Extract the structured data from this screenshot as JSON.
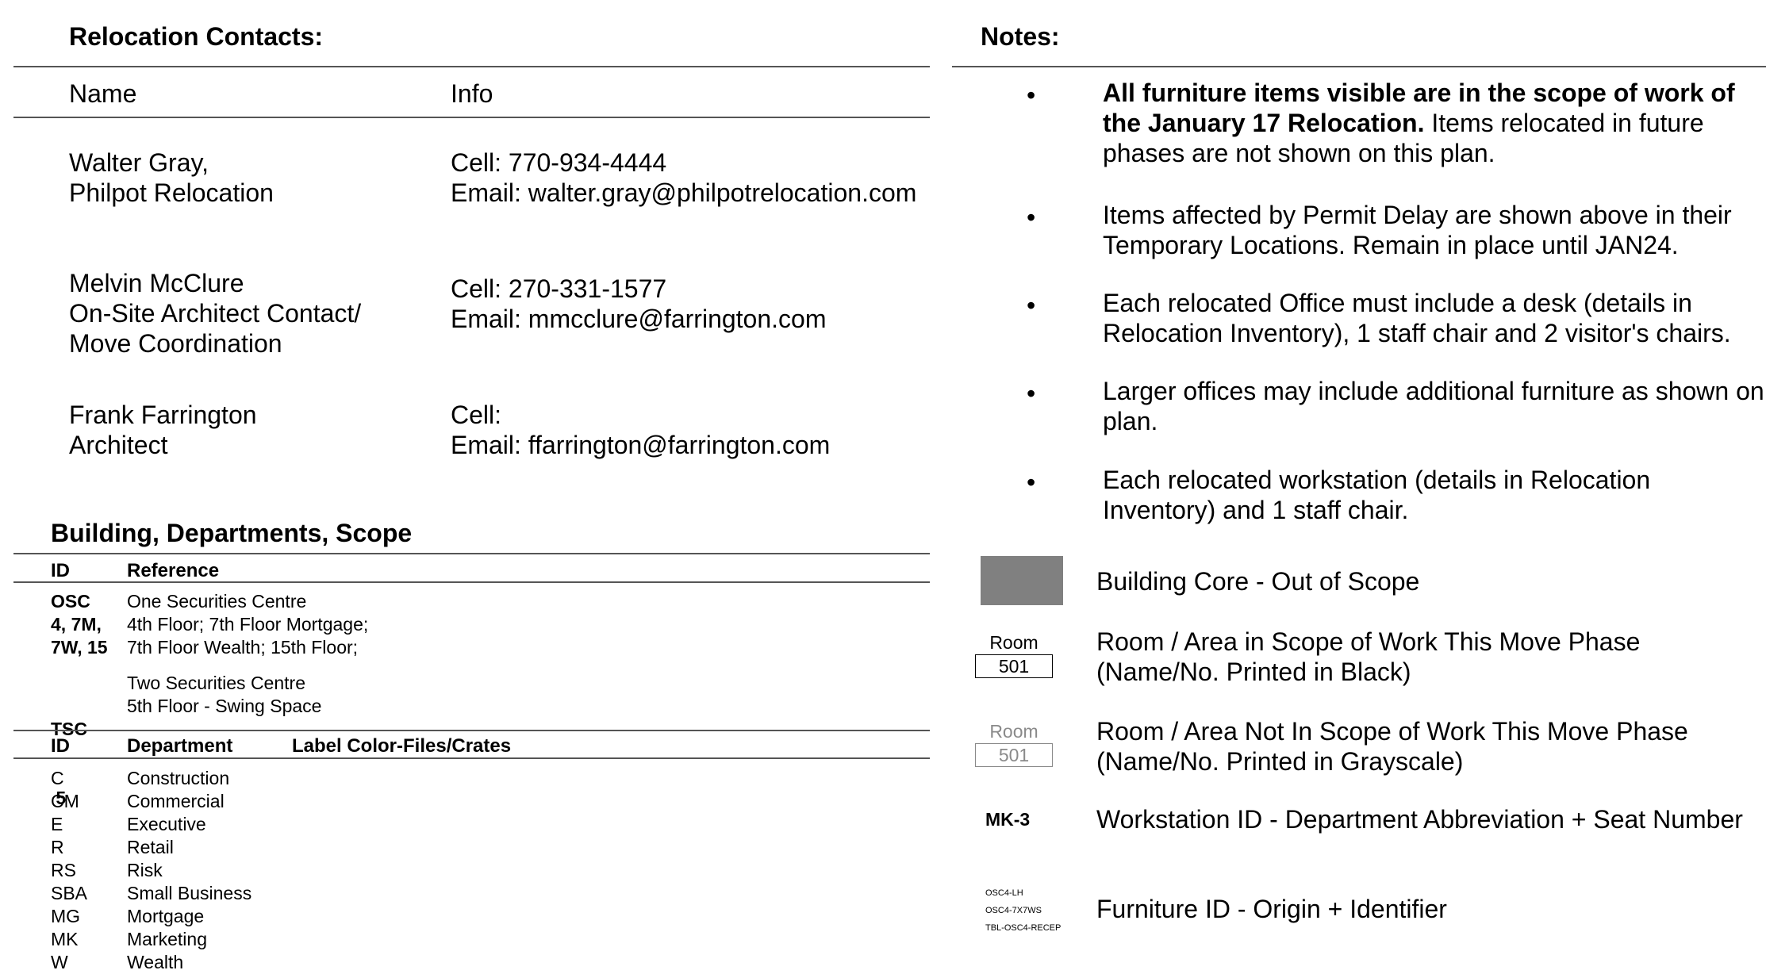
{
  "contacts": {
    "title": "Relocation Contacts:",
    "columns": [
      "Name",
      "Info"
    ],
    "items": [
      {
        "name_lines": [
          "Walter Gray,",
          "Philpot Relocation"
        ],
        "info_lines": [
          "Cell: 770-934-4444",
          "Email: walter.gray@philpotrelocation.com"
        ]
      },
      {
        "name_lines": [
          "Melvin McClure",
          "On-Site Architect Contact/",
          "Move Coordination"
        ],
        "info_lines": [
          "Cell: 270-331-1577",
          "Email: mmcclure@farrington.com"
        ]
      },
      {
        "name_lines": [
          "Frank Farrington",
          "Architect"
        ],
        "info_lines": [
          "Cell:",
          "Email: ffarrington@farrington.com"
        ]
      }
    ]
  },
  "building": {
    "title": "Building, Departments, Scope",
    "headers": [
      "ID",
      "Reference"
    ],
    "groups": [
      {
        "ids": [
          "OSC",
          "4, 7M,",
          "7W, 15"
        ],
        "refs": [
          "One Securities Centre",
          "4th Floor; 7th Floor Mortgage;",
          "7th Floor Wealth; 15th Floor;"
        ]
      },
      {
        "ids": [
          "TSC",
          " 5"
        ],
        "refs": [
          "Two Securities Centre",
          "5th Floor - Swing Space"
        ]
      }
    ]
  },
  "departments": {
    "headers": [
      "ID",
      "Department",
      "Label Color-Files/Crates"
    ],
    "rows": [
      {
        "id": "C",
        "name": "Construction"
      },
      {
        "id": "CM",
        "name": "Commercial"
      },
      {
        "id": "E",
        "name": "Executive"
      },
      {
        "id": "R",
        "name": "Retail"
      },
      {
        "id": "RS",
        "name": "Risk"
      },
      {
        "id": "SBA",
        "name": "Small Business"
      },
      {
        "id": "MG",
        "name": "Mortgage"
      },
      {
        "id": "MK",
        "name": "Marketing"
      },
      {
        "id": "W",
        "name": "Wealth"
      }
    ]
  },
  "notes": {
    "title": "Notes:",
    "bullet": "•",
    "items": [
      {
        "bold": "All furniture items visible are in the scope of work of the January 17 Relocation.",
        "text": " Items relocated in future phases are not shown on this plan."
      },
      {
        "bold": "",
        "text": "Items affected by Permit Delay are shown above in their Temporary Locations.  Remain in place until JAN24."
      },
      {
        "bold": "",
        "text": "Each relocated Office must include a desk (details in Relocation Inventory), 1 staff chair and 2 visitor's chairs."
      },
      {
        "bold": "",
        "text": "Larger offices may include additional furniture as shown on plan."
      },
      {
        "bold": "",
        "text": "Each relocated workstation (details in Relocation Inventory) and 1 staff chair."
      }
    ]
  },
  "legend": {
    "core": {
      "text": "Building Core - Out of Scope",
      "color": "#808080"
    },
    "in_scope": {
      "room_label": "Room",
      "room_no": "501",
      "text": "Room / Area in Scope of Work This Move Phase (Name/No. Printed in Black)"
    },
    "out_scope": {
      "room_label": "Room",
      "room_no": "501",
      "text": "Room / Area Not In Scope of Work This Move Phase (Name/No. Printed in Grayscale)",
      "color": "#8a8a8a"
    },
    "workstation": {
      "sample": "MK-3",
      "text": "Workstation ID - Department Abbreviation + Seat Number"
    },
    "furniture": {
      "samples": [
        "OSC4-LH",
        "OSC4-7X7WS",
        "TBL-OSC4-RECEP"
      ],
      "text": "Furniture ID - Origin + Identifier"
    }
  }
}
